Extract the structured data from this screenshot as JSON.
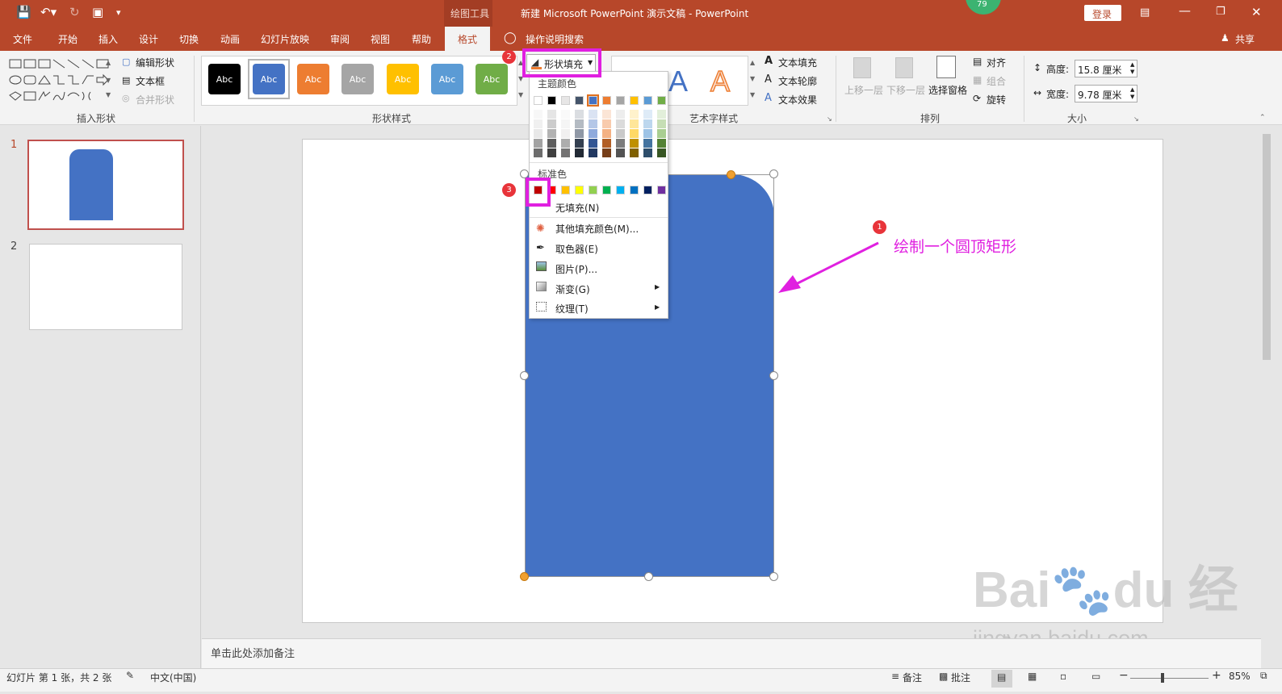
{
  "window": {
    "title": "新建 Microsoft PowerPoint 演示文稿  -  PowerPoint",
    "context_tab": "绘图工具",
    "login": "登录",
    "user_count": "79",
    "share": "共享",
    "search_hint": "操作说明搜索"
  },
  "tabs": [
    "文件",
    "开始",
    "插入",
    "设计",
    "切换",
    "动画",
    "幻灯片放映",
    "审阅",
    "视图",
    "帮助",
    "格式"
  ],
  "ribbon": {
    "insert_shapes": {
      "label": "插入形状",
      "edit_shape": "编辑形状",
      "text_box": "文本框",
      "merge_shapes": "合并形状"
    },
    "shape_styles": {
      "label": "形状样式",
      "styles": [
        {
          "text": "Abc",
          "color": "#000000"
        },
        {
          "text": "Abc",
          "color": "#4472c4"
        },
        {
          "text": "Abc",
          "color": "#ed7d31"
        },
        {
          "text": "Abc",
          "color": "#a5a5a5"
        },
        {
          "text": "Abc",
          "color": "#ffc000"
        },
        {
          "text": "Abc",
          "color": "#5b9bd5"
        },
        {
          "text": "Abc",
          "color": "#70ad47"
        }
      ],
      "shape_fill": "形状填充"
    },
    "wordart": {
      "label": "艺术字样式",
      "text_fill": "文本填充",
      "text_outline": "文本轮廓",
      "text_effects": "文本效果"
    },
    "arrange": {
      "label": "排列",
      "bring_forward": "上移一层",
      "send_backward": "下移一层",
      "selection_pane": "选择窗格",
      "align": "对齐",
      "group": "组合",
      "rotate": "旋转"
    },
    "size": {
      "label": "大小",
      "height_label": "高度:",
      "height_value": "15.8 厘米",
      "width_label": "宽度:",
      "width_value": "9.78 厘米"
    }
  },
  "slides": [
    {
      "number": "1"
    },
    {
      "number": "2"
    }
  ],
  "dropdown": {
    "theme_colors_label": "主题颜色",
    "standard_colors_label": "标准色",
    "theme_top": [
      "#ffffff",
      "#000000",
      "#e7e6e6",
      "#44546a",
      "#4472c4",
      "#ed7d31",
      "#a5a5a5",
      "#ffc000",
      "#5b9bd5",
      "#70ad47"
    ],
    "standard": [
      "#c00000",
      "#ff0000",
      "#ffc000",
      "#ffff00",
      "#92d050",
      "#00b050",
      "#00b0f0",
      "#0070c0",
      "#002060",
      "#7030a0"
    ],
    "no_fill": "无填充(N)",
    "more_colors": "其他填充颜色(M)...",
    "eyedropper": "取色器(E)",
    "picture": "图片(P)...",
    "gradient": "渐变(G)",
    "texture": "纹理(T)"
  },
  "annotations": {
    "step1_badge": "1",
    "step1_text": "绘制一个圆顶矩形",
    "step2_badge": "2",
    "step3_badge": "3",
    "text_color": "#e020e0"
  },
  "notes_placeholder": "单击此处添加备注",
  "status": {
    "slide_info": "幻灯片 第 1 张，共 2 张",
    "language": "中文(中国)",
    "notes": "备注",
    "comments": "批注",
    "zoom": "85%"
  },
  "watermark": "jingyan.baidu.com",
  "shape_color": "#4472c4"
}
